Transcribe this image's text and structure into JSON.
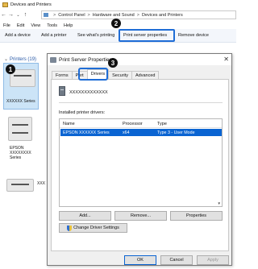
{
  "window": {
    "title": "Devices and Printers"
  },
  "address": {
    "crumbs": [
      "Control Panel",
      "Hardware and Sound",
      "Devices and Printers"
    ],
    "separator": ">"
  },
  "menu": [
    "File",
    "Edit",
    "View",
    "Tools",
    "Help"
  ],
  "toolbar": {
    "add_device": "Add a device",
    "add_printer": "Add a printer",
    "see_printing": "See what's printing",
    "print_server": "Print server properties",
    "remove_device": "Remove device"
  },
  "sidebar": {
    "printers_header": "Printers (19)"
  },
  "printers": [
    {
      "label": "XXXXXX Series"
    },
    {
      "label": "EPSON\nXXXXXXXX\nSeries"
    },
    {
      "label": "XXX"
    }
  ],
  "callouts": [
    "1",
    "2",
    "3"
  ],
  "dialog": {
    "title": "Print Server Properties",
    "close": "✕",
    "tabs": [
      "Forms",
      "Port",
      "Drivers",
      "Security",
      "Advanced"
    ],
    "server_name": "XXXXXXXXXXXXX",
    "installed_label": "Installed printer drivers:",
    "columns": [
      "Name",
      "Processor",
      "Type"
    ],
    "rows": [
      {
        "name": "EPSON XXXXXX Series",
        "processor": "x64",
        "type": "Type 3 - User Mode"
      }
    ],
    "buttons": {
      "add": "Add...",
      "remove": "Remove...",
      "properties": "Properties",
      "change_settings": "Change Driver Settings",
      "ok": "OK",
      "cancel": "Cancel",
      "apply": "Apply"
    }
  },
  "colors": {
    "accent": "#1f6dd6",
    "selection": "#0a64d2"
  }
}
